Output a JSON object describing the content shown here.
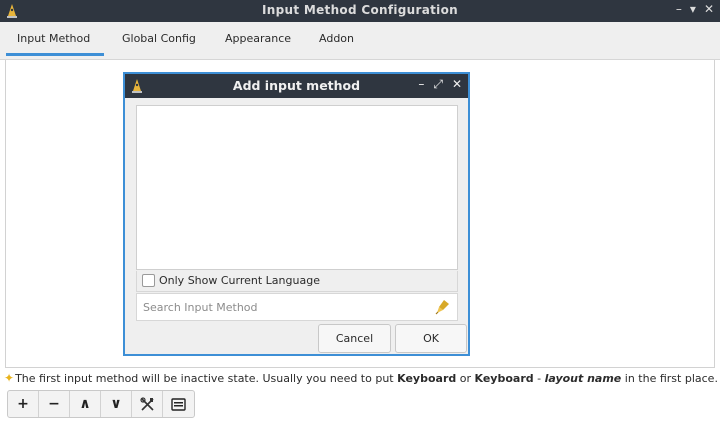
{
  "window": {
    "title": "Input Method Configuration",
    "controls": [
      "–",
      "▾",
      "✕"
    ]
  },
  "tabs": [
    {
      "label": "Input Method",
      "active": true
    },
    {
      "label": "Global Config",
      "active": false
    },
    {
      "label": "Appearance",
      "active": false
    },
    {
      "label": "Addon",
      "active": false
    }
  ],
  "hint": {
    "prefix": "The first input method will be inactive state. Usually you need to put ",
    "keyword1": "Keyboard",
    "mid": " or ",
    "keyword2": "Keyboard",
    "dash": " - ",
    "italic": "layout name",
    "suffix": " in the first place."
  },
  "toolbar": {
    "add": "+",
    "remove": "−",
    "up": "∧",
    "down": "∨"
  },
  "dialog": {
    "title": "Add input method",
    "controls": [
      "–",
      "⤢",
      "✕"
    ],
    "only_show_current_language": "Only Show Current Language",
    "search_placeholder": "Search Input Method",
    "cancel_label": "Cancel",
    "ok_label": "OK"
  },
  "colors": {
    "accent": "#3d8fd6",
    "titlebar": "#2f3640",
    "hint_star": "#e9b31c"
  }
}
